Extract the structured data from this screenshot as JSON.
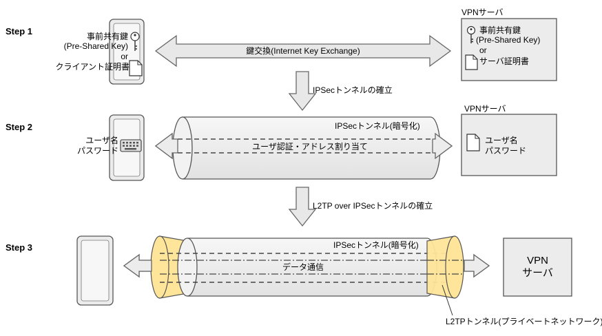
{
  "steps": [
    {
      "label": "Step 1",
      "client": {
        "psk": "事前共有鍵",
        "psk_en": "(Pre-Shared Key)",
        "or": "or",
        "cert": "クライアント証明書"
      },
      "server": {
        "title": "VPNサーバ",
        "psk": "事前共有鍵",
        "psk_en": "(Pre-Shared Key)",
        "or": "or",
        "cert": "サーバ証明書"
      },
      "exchange": "鍵交換(Internet Key Exchange)"
    },
    {
      "label": "Step 2",
      "client": {
        "user": "ユーザ名",
        "password": "パスワード"
      },
      "server": {
        "title": "VPNサーバ",
        "user": "ユーザ名",
        "password": "パスワード"
      },
      "tunnel": "IPSecトンネル(暗号化)",
      "action": "ユーザ認証・アドレス割り当て"
    },
    {
      "label": "Step 3",
      "server": {
        "line1": "VPN",
        "line2": "サーバ"
      },
      "tunnel": "IPSecトンネル(暗号化)",
      "action": "データ通信",
      "l2tp_label": "L2TPトンネル(プライベートネットワーク)"
    }
  ],
  "transitions": [
    "IPSecトンネルの確立",
    "L2TP over IPSecトンネルの確立"
  ],
  "colors": {
    "device_fill": "#f2f2f2",
    "stroke": "#555555",
    "cone_fill": "#ffe599"
  }
}
